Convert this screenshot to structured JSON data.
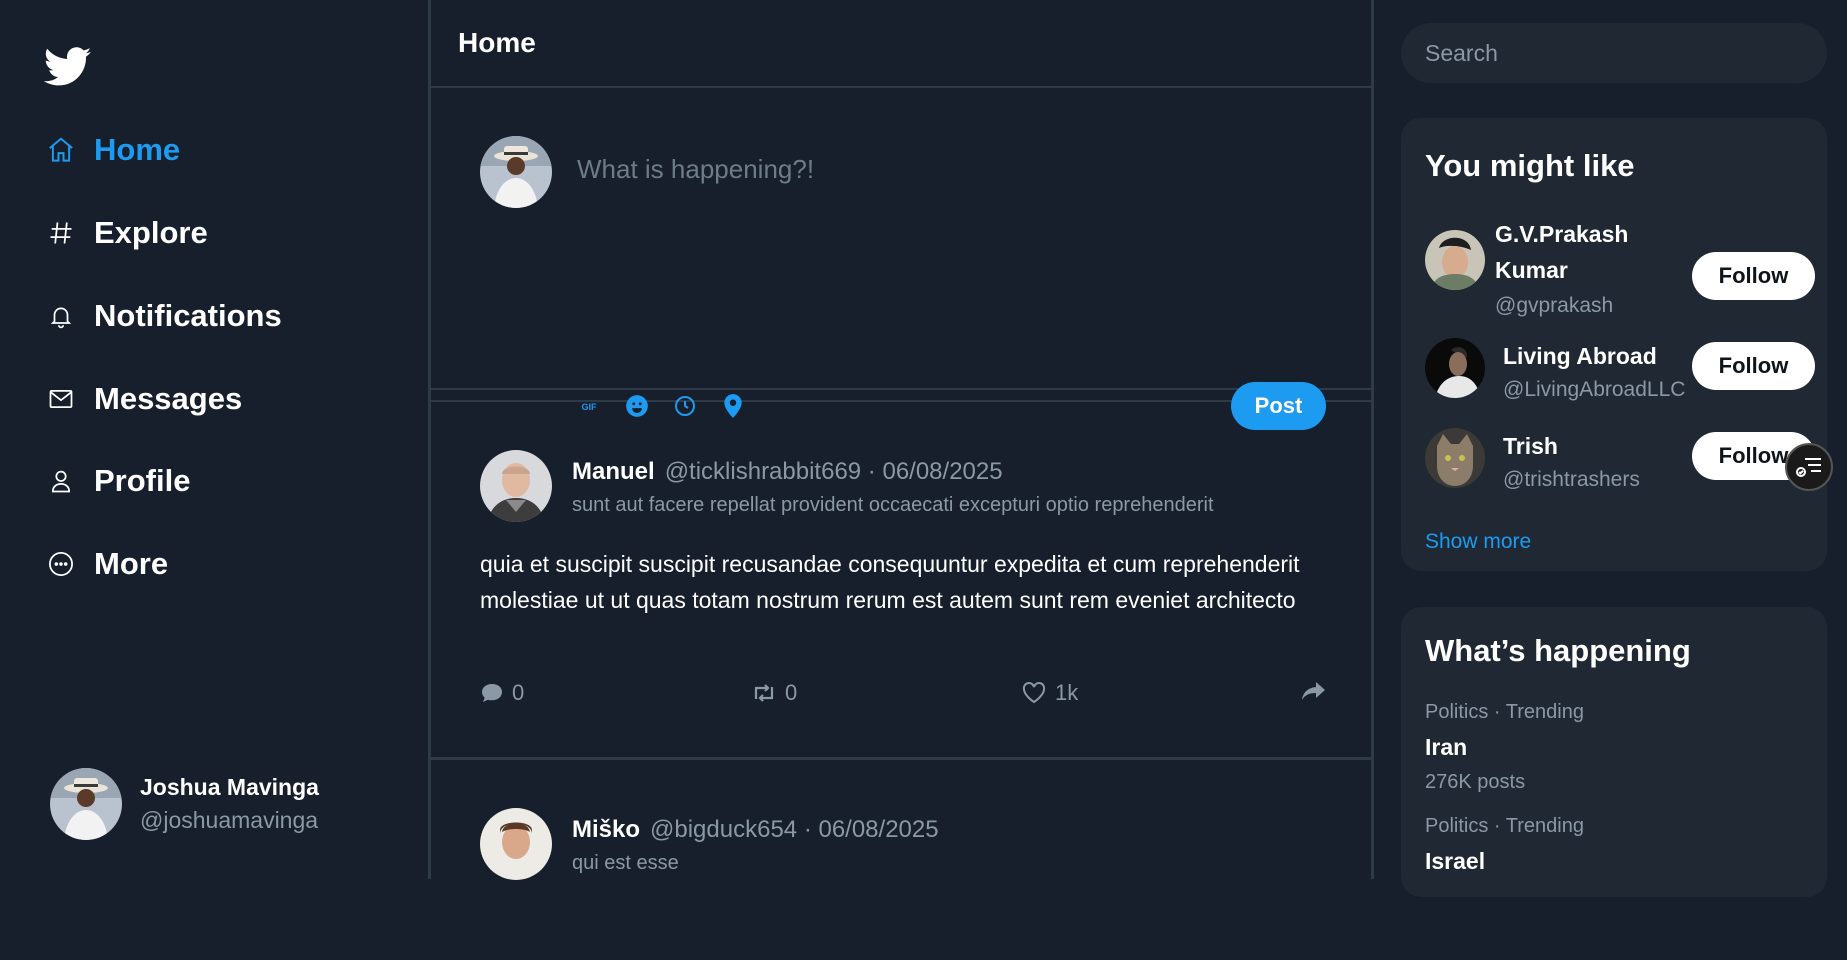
{
  "colors": {
    "background": "#161f2b",
    "accent": "#1d9bf0",
    "card": "#202833",
    "muted": "#8b98a5"
  },
  "sidebar": {
    "logo_icon": "twitter-bird-icon",
    "items": [
      {
        "label": "Home",
        "icon": "home-icon",
        "active": true
      },
      {
        "label": "Explore",
        "icon": "hashtag-icon"
      },
      {
        "label": "Notifications",
        "icon": "bell-icon"
      },
      {
        "label": "Messages",
        "icon": "envelope-icon"
      },
      {
        "label": "Profile",
        "icon": "person-icon"
      },
      {
        "label": "More",
        "icon": "more-circle-icon"
      }
    ],
    "user": {
      "name": "Joshua Mavinga",
      "handle": "@joshuamavinga"
    }
  },
  "main": {
    "title": "Home",
    "compose": {
      "placeholder": "What is happening?!",
      "tools": [
        "gif-icon",
        "emoji-icon",
        "schedule-icon",
        "location-icon"
      ],
      "post_label": "Post"
    },
    "tweets": [
      {
        "name": "Manuel",
        "meta": "@ticklishrabbit669 · 06/08/2025",
        "title": "sunt aut facere repellat provident occaecati excepturi optio reprehenderit",
        "body": "quia et suscipit suscipit recusandae consequuntur expedita et cum reprehenderit molestiae ut ut quas totam nostrum rerum est autem sunt rem eveniet architecto",
        "replies": "0",
        "retweets": "0",
        "likes": "1k"
      },
      {
        "name": "Miško",
        "meta": "@bigduck654 · 06/08/2025",
        "title": "qui est esse"
      }
    ]
  },
  "right": {
    "search_placeholder": "Search",
    "suggestions": {
      "title": "You might like",
      "users": [
        {
          "name_line1": "G.V.Prakash",
          "name_line2": "Kumar",
          "handle": "@gvprakash",
          "follow": "Follow"
        },
        {
          "name": "Living Abroad",
          "handle": "@LivingAbroadLLC",
          "follow": "Follow"
        },
        {
          "name": "Trish",
          "handle": "@trishtrashers",
          "follow": "Follow"
        }
      ],
      "show_more": "Show more"
    },
    "happening": {
      "title": "What’s happening",
      "trends": [
        {
          "category": "Politics · Trending",
          "name": "Iran",
          "count": "276K posts"
        },
        {
          "category": "Politics · Trending",
          "name": "Israel"
        }
      ]
    }
  }
}
